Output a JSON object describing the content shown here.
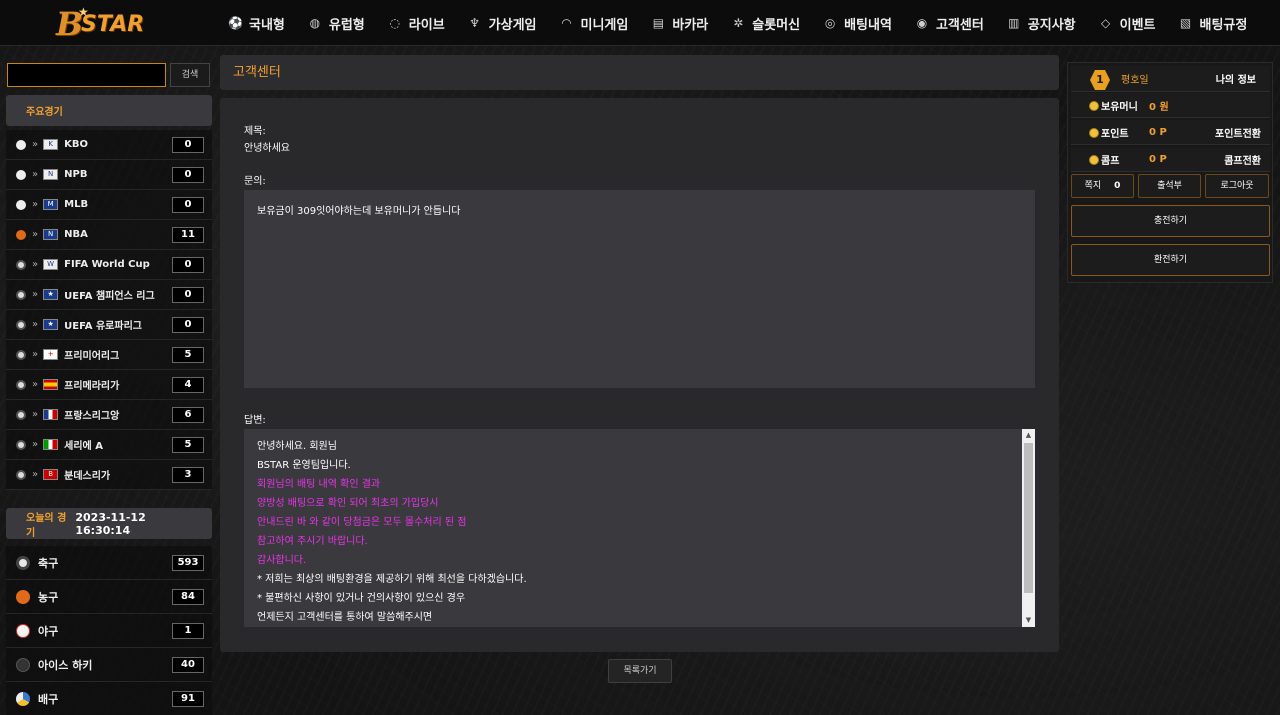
{
  "logo": {
    "text": "STAR",
    "letter": "B"
  },
  "nav": [
    {
      "label": "국내형",
      "icon": "soccer-icon"
    },
    {
      "label": "유럽형",
      "icon": "basketball-icon"
    },
    {
      "label": "라이브",
      "icon": "baseball-icon"
    },
    {
      "label": "가상게임",
      "icon": "trophy-icon"
    },
    {
      "label": "미니게임",
      "icon": "headset-icon"
    },
    {
      "label": "바카라",
      "icon": "cards-icon"
    },
    {
      "label": "슬롯머신",
      "icon": "gear-icon"
    },
    {
      "label": "배팅내역",
      "icon": "target-icon"
    },
    {
      "label": "고객센터",
      "icon": "eye-icon"
    },
    {
      "label": "공지사항",
      "icon": "document-icon"
    },
    {
      "label": "이벤트",
      "icon": "diamond-icon"
    },
    {
      "label": "배팅규정",
      "icon": "receipt-icon"
    }
  ],
  "search": {
    "placeholder": "",
    "value": "",
    "button": "검색"
  },
  "featured": {
    "title": "주요경기",
    "leagues": [
      {
        "name": "KBO",
        "count": "0",
        "sport": "baseball"
      },
      {
        "name": "NPB",
        "count": "0",
        "sport": "baseball"
      },
      {
        "name": "MLB",
        "count": "0",
        "sport": "baseball"
      },
      {
        "name": "NBA",
        "count": "11",
        "sport": "basketball"
      },
      {
        "name": "FIFA World Cup",
        "count": "0",
        "sport": "soccer"
      },
      {
        "name": "UEFA 챔피언스 리그",
        "count": "0",
        "sport": "soccer"
      },
      {
        "name": "UEFA 유로파리그",
        "count": "0",
        "sport": "soccer"
      },
      {
        "name": "프리미어리그",
        "count": "5",
        "sport": "soccer"
      },
      {
        "name": "프리메라리가",
        "count": "4",
        "sport": "soccer"
      },
      {
        "name": "프랑스리그앙",
        "count": "6",
        "sport": "soccer"
      },
      {
        "name": "세리에 A",
        "count": "5",
        "sport": "soccer"
      },
      {
        "name": "분데스리가",
        "count": "3",
        "sport": "soccer"
      }
    ]
  },
  "today": {
    "title": "오늘의 경기",
    "datetime": "2023-11-12 16:30:14",
    "sports": [
      {
        "name": "축구",
        "count": "593",
        "color": "#e8e8e8"
      },
      {
        "name": "농구",
        "count": "84",
        "color": "#e06a1a"
      },
      {
        "name": "야구",
        "count": "1",
        "color": "#f4f4f4"
      },
      {
        "name": "아이스 하키",
        "count": "40",
        "color": "#333333"
      },
      {
        "name": "배구",
        "count": "91",
        "color": "#3a7ad0"
      }
    ]
  },
  "main": {
    "title": "고객센터",
    "subject_label": "제목:",
    "subject": "안녕하세요",
    "inquiry_label": "문의:",
    "inquiry": "보유금이 309잇어야하는데 보유머니가 안듭니다",
    "answer_label": "답변:",
    "answer_lines": [
      {
        "text": "안녕하세요. 회원님",
        "pink": false
      },
      {
        "text": "BSTAR 운영팀입니다.",
        "pink": false
      },
      {
        "text": "회원님의 배팅 내역 확인 결과",
        "pink": true
      },
      {
        "text": "양방성 배팅으로 확인 되어 최초의 가입당시",
        "pink": true
      },
      {
        "text": "안내드린 바 와 같이 당첨금은 모두 몰수처리 된 점",
        "pink": true
      },
      {
        "text": "참고하여 주시기 바랍니다.",
        "pink": true
      },
      {
        "text": "감사합니다.",
        "pink": true
      },
      {
        "text": "* 저희는 최상의 배팅환경을 제공하기 위해 최선을 다하겠습니다.",
        "pink": false
      },
      {
        "text": "* 불편하신 사항이 있거나 건의사항이 있으신 경우",
        "pink": false
      },
      {
        "text": "언제든지 고객센터를 통하여 말씀해주시면",
        "pink": false
      }
    ],
    "list_button": "목록가기"
  },
  "account": {
    "level": "1",
    "grade": "평호일",
    "my_info": "나의 정보",
    "money_label": "보유머니",
    "money_value": "0 원",
    "point_label": "포인트",
    "point_value": "0 P",
    "point_convert": "포인트전환",
    "comp_label": "콤프",
    "comp_value": "0 P",
    "comp_convert": "콤프전환",
    "message_label": "쪽지",
    "message_count": "0",
    "attendance": "출석부",
    "logout": "로그아웃",
    "deposit": "충전하기",
    "withdraw": "환전하기"
  }
}
